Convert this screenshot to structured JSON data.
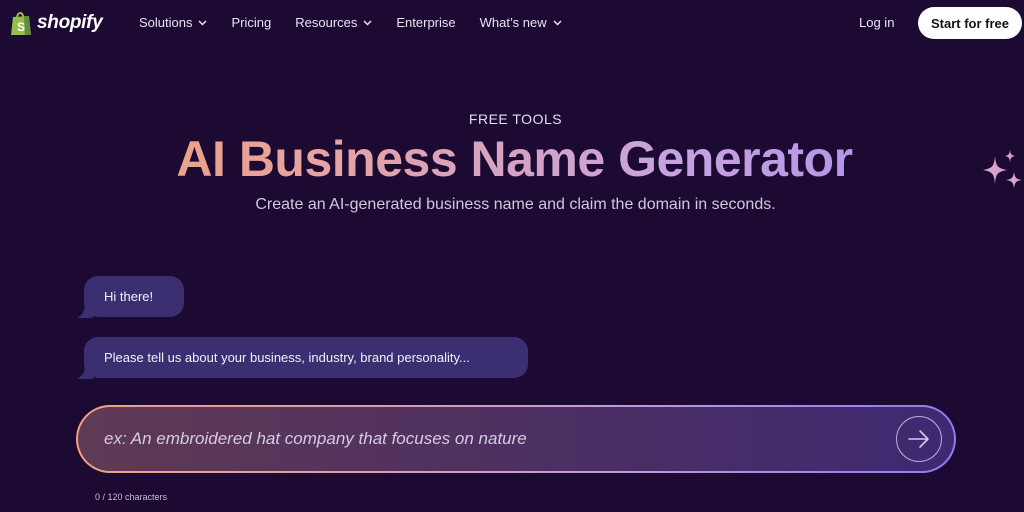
{
  "header": {
    "logo_text": "shopify",
    "logo_icon": "shopping-bag-icon",
    "nav": [
      {
        "label": "Solutions",
        "dropdown": true
      },
      {
        "label": "Pricing",
        "dropdown": false
      },
      {
        "label": "Resources",
        "dropdown": true
      },
      {
        "label": "Enterprise",
        "dropdown": false
      },
      {
        "label": "What’s new",
        "dropdown": true
      }
    ],
    "login_label": "Log in",
    "cta_label": "Start for free"
  },
  "hero": {
    "eyebrow": "FREE TOOLS",
    "title": "AI Business Name Generator",
    "subtitle": "Create an AI-generated business name and claim the domain in seconds."
  },
  "chat": {
    "messages": [
      {
        "text": "Hi there!"
      },
      {
        "text": "Please tell us about your business, industry, brand personality..."
      }
    ]
  },
  "input": {
    "value": "",
    "placeholder": "ex: An embroidered hat company that focuses on nature",
    "char_count": "0 / 120 characters",
    "send_icon": "arrow-right-icon"
  },
  "colors": {
    "background": "#1c0a33",
    "bubble": "#3b2f72",
    "title_gradient": [
      "#f0a06a",
      "#c6a3df",
      "#a889ee"
    ]
  }
}
